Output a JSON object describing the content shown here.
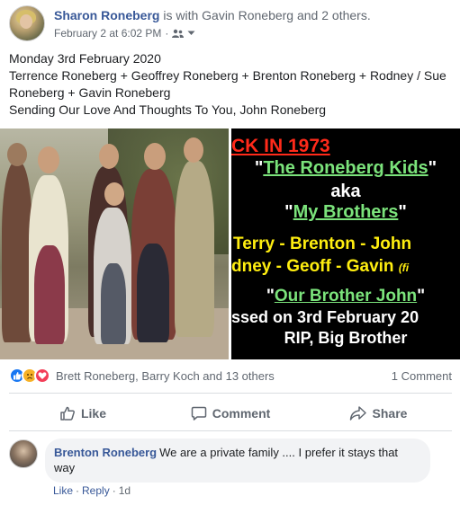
{
  "post": {
    "author": "Sharon Roneberg",
    "with_text": "is with Gavin Roneberg and 2 others.",
    "timestamp": "February 2 at 6:02 PM",
    "meta_separator": "·",
    "audience_icon": "friends-icon",
    "lines": [
      "Monday 3rd February 2020",
      "Terrence Roneberg + Geoffrey Roneberg + Brenton Roneberg + Rodney / Sue Roneberg + Gavin Roneberg",
      "Sending Our Love And Thoughts To You, John Roneberg"
    ]
  },
  "memorial_image": {
    "year_line": "CK  IN  1973",
    "kids_quote_open": "\"",
    "kids_title": "The Roneberg Kids",
    "kids_quote_close": "\"",
    "aka": "aka",
    "brothers_quote_open": "\"",
    "brothers_title": "My Brothers",
    "brothers_quote_close": "\"",
    "names_line1": "Terry - Brenton - John",
    "names_line2": "dney - Geoff - Gavin",
    "names_line2_small": "(fi",
    "john_quote_open": "\"",
    "john_title": "Our Brother John",
    "john_quote_close": "\"",
    "passed_line": "ssed on 3rd February 20",
    "rip_line": "RIP, Big Brother"
  },
  "reactions": {
    "icons": [
      "like-icon",
      "sad-icon",
      "love-icon"
    ],
    "names": "Brett Roneberg, Barry Koch and 13 others",
    "comment_count": "1 Comment"
  },
  "actions": {
    "like": "Like",
    "comment": "Comment",
    "share": "Share"
  },
  "comment": {
    "author": "Brenton Roneberg",
    "text": "We are a private family .... I prefer it stays that way",
    "like_link": "Like",
    "separator": "·",
    "reply_link": "Reply",
    "age": "1d"
  },
  "colors": {
    "link_blue": "#385898",
    "like_blue": "#1877f2",
    "memorial_yellow": "#ffee10",
    "memorial_green": "#7be37b",
    "memorial_red": "#ff2a1a"
  }
}
